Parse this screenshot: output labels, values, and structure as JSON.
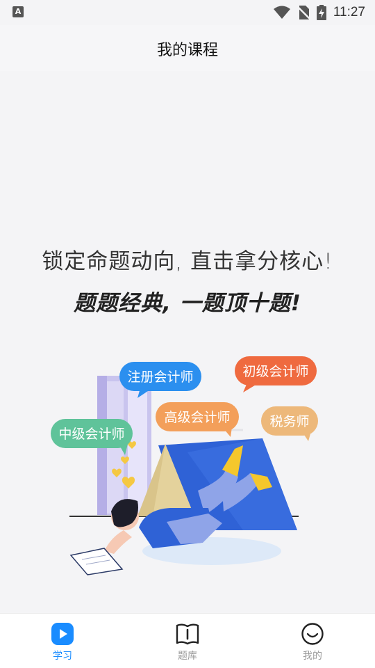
{
  "status_bar": {
    "time": "11:27",
    "app_badge": "A"
  },
  "header": {
    "title": "我的课程"
  },
  "promo": {
    "slogan_primary": "锁定命题动向, 直击拿分核心!",
    "slogan_secondary": "题题经典, 一题顶十题!"
  },
  "illustration": {
    "bubbles": [
      {
        "label": "注册会计师",
        "color": "#2b8fef"
      },
      {
        "label": "初级会计师",
        "color": "#ef6a3f"
      },
      {
        "label": "高级会计师",
        "color": "#f39f5a"
      },
      {
        "label": "中级会计师",
        "color": "#5fc39a"
      },
      {
        "label": "税务师",
        "color": "#edb87a"
      }
    ]
  },
  "tabs": [
    {
      "label": "学习",
      "icon": "play-icon",
      "active": true
    },
    {
      "label": "题库",
      "icon": "book-icon",
      "active": false
    },
    {
      "label": "我的",
      "icon": "smile-icon",
      "active": false
    }
  ],
  "colors": {
    "accent": "#1a8cff",
    "background": "#f4f4f6",
    "inactive": "#9a9a9a"
  }
}
